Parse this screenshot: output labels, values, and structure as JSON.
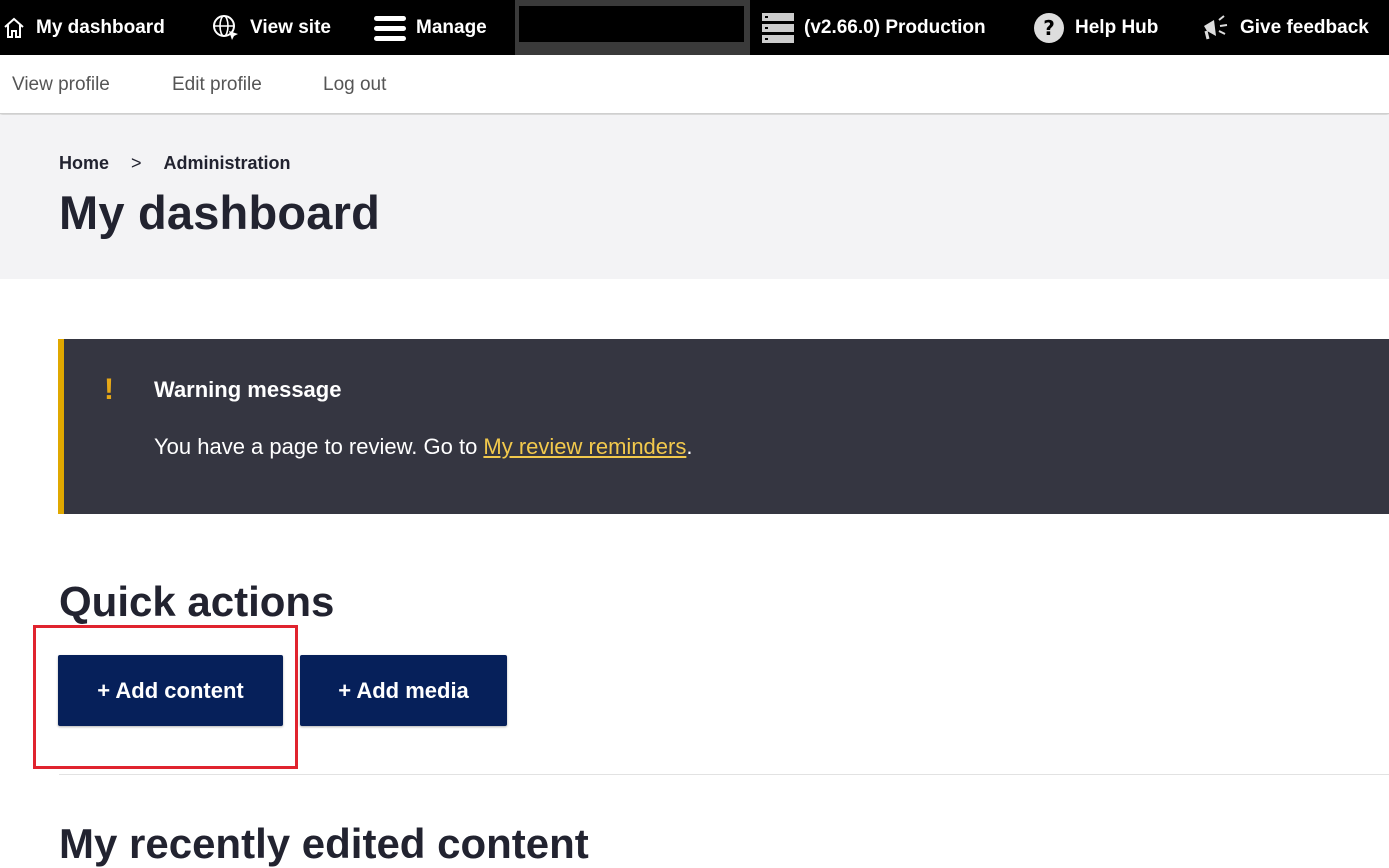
{
  "toolbar": {
    "dashboard_label": "My dashboard",
    "view_site_label": "View site",
    "manage_label": "Manage",
    "environment_label": "(v2.66.0) Production",
    "help_label": "Help Hub",
    "feedback_label": "Give feedback",
    "icons": {
      "dashboard": "home-icon",
      "view_site": "globe-icon",
      "manage": "hamburger-menu-icon",
      "environment": "server-stack-icon",
      "help": "question-circle-icon",
      "feedback": "megaphone-icon"
    }
  },
  "tray": {
    "view_profile": "View profile",
    "edit_profile": "Edit profile",
    "log_out": "Log out"
  },
  "header": {
    "breadcrumb": [
      "Home",
      "Administration"
    ],
    "breadcrumb_separator": ">",
    "title": "My dashboard"
  },
  "warning": {
    "icon": "!",
    "title": "Warning message",
    "text_before": "You have a page to review. Go to ",
    "link_text": "My review reminders",
    "text_after": "."
  },
  "quick_actions": {
    "title": "Quick actions",
    "add_content": "+ Add content",
    "add_media": "+ Add media"
  },
  "recent": {
    "title": "My recently edited content"
  },
  "colors": {
    "toolbar_bg": "#000000",
    "button_bg": "#06205a",
    "warning_bg": "#353641",
    "warning_accent": "#e0a800",
    "link_color": "#f2c94c",
    "highlight": "#e0232e"
  }
}
